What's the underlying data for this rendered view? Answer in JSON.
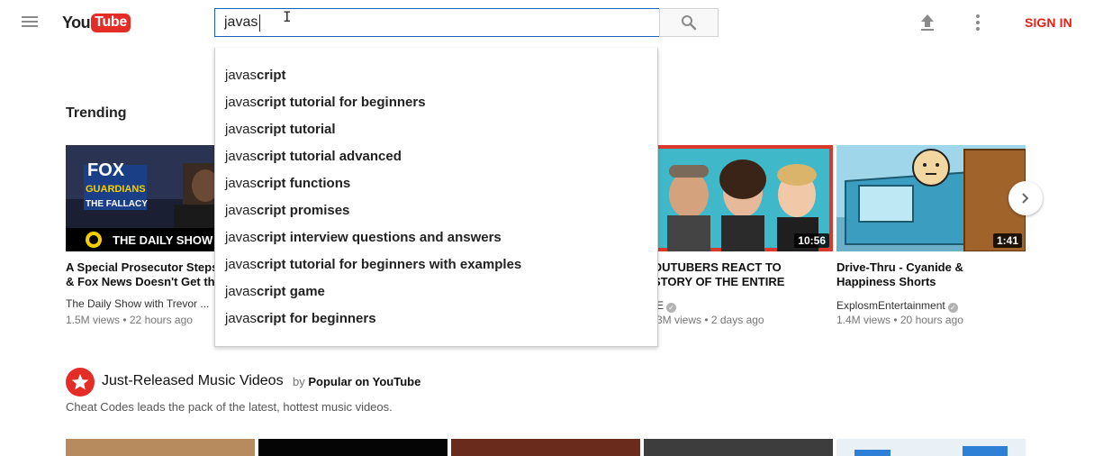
{
  "header": {
    "logo_you": "You",
    "logo_tube": "Tube",
    "search_value": "javas",
    "sign_in": "SIGN IN"
  },
  "suggestions": {
    "typed_prefix": "javas",
    "items": [
      "cript",
      "cript tutorial for beginners",
      "cript tutorial",
      "cript tutorial advanced",
      "cript functions",
      "cript promises",
      "cript interview questions and answers",
      "cript tutorial for beginners with examples",
      "cript game",
      "cript for beginners"
    ]
  },
  "trending": {
    "title": "Trending",
    "videos": [
      {
        "title_line1": "A Special Prosecutor Steps",
        "title_line2": "& Fox News Doesn't Get th",
        "channel": "The Daily Show with Trevor ...",
        "meta": "1.5M views • 22 hours ago",
        "duration": "",
        "thumb_text_1": "FOX",
        "thumb_text_2": "GUARDIANS",
        "thumb_text_3": "THE FALLACY",
        "thumb_banner": "THE DAILY SHOW"
      },
      {
        "title_line1": "OUTUBERS REACT TO",
        "title_line2": "STORY OF THE ENTIRE",
        "channel": "E",
        "meta": "3M views • 2 days ago",
        "duration": "10:56"
      },
      {
        "title_line1": "Drive-Thru - Cyanide &",
        "title_line2": "Happiness Shorts",
        "channel": "ExplosmEntertainment",
        "meta": "1.4M views • 20 hours ago",
        "duration": "1:41"
      }
    ]
  },
  "music": {
    "title": "Just-Released Music Videos",
    "by_prefix": "by",
    "by_name": "Popular on YouTube",
    "description": "Cheat Codes leads the pack of the latest, hottest music videos."
  },
  "colors": {
    "brand_red": "#e52d27",
    "sign_in_red": "#e62117",
    "search_border": "#1c62b9"
  },
  "icons": [
    "menu-icon",
    "search-icon",
    "upload-icon",
    "more-vert-icon",
    "chevron-right-icon",
    "verified-icon",
    "star-icon"
  ]
}
